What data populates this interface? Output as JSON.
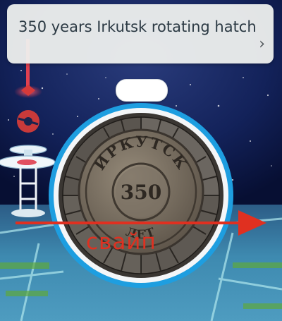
{
  "header": {
    "title": "350 years Irkutsk rotating hatch",
    "chevron_icon": "chevron-right-icon"
  },
  "pokestop": {
    "medallion_top_text": "ИРКУТСК",
    "medallion_number": "350",
    "medallion_bottom_text": "ЛЕТ"
  },
  "annotation": {
    "swipe_text": "свайп"
  },
  "colors": {
    "background": "#0c1a4a",
    "header_card": "#eef0ee",
    "disc_ring": "#1e9ee0",
    "annotation": "#e03020",
    "gym_marker": "#d63a3a"
  }
}
